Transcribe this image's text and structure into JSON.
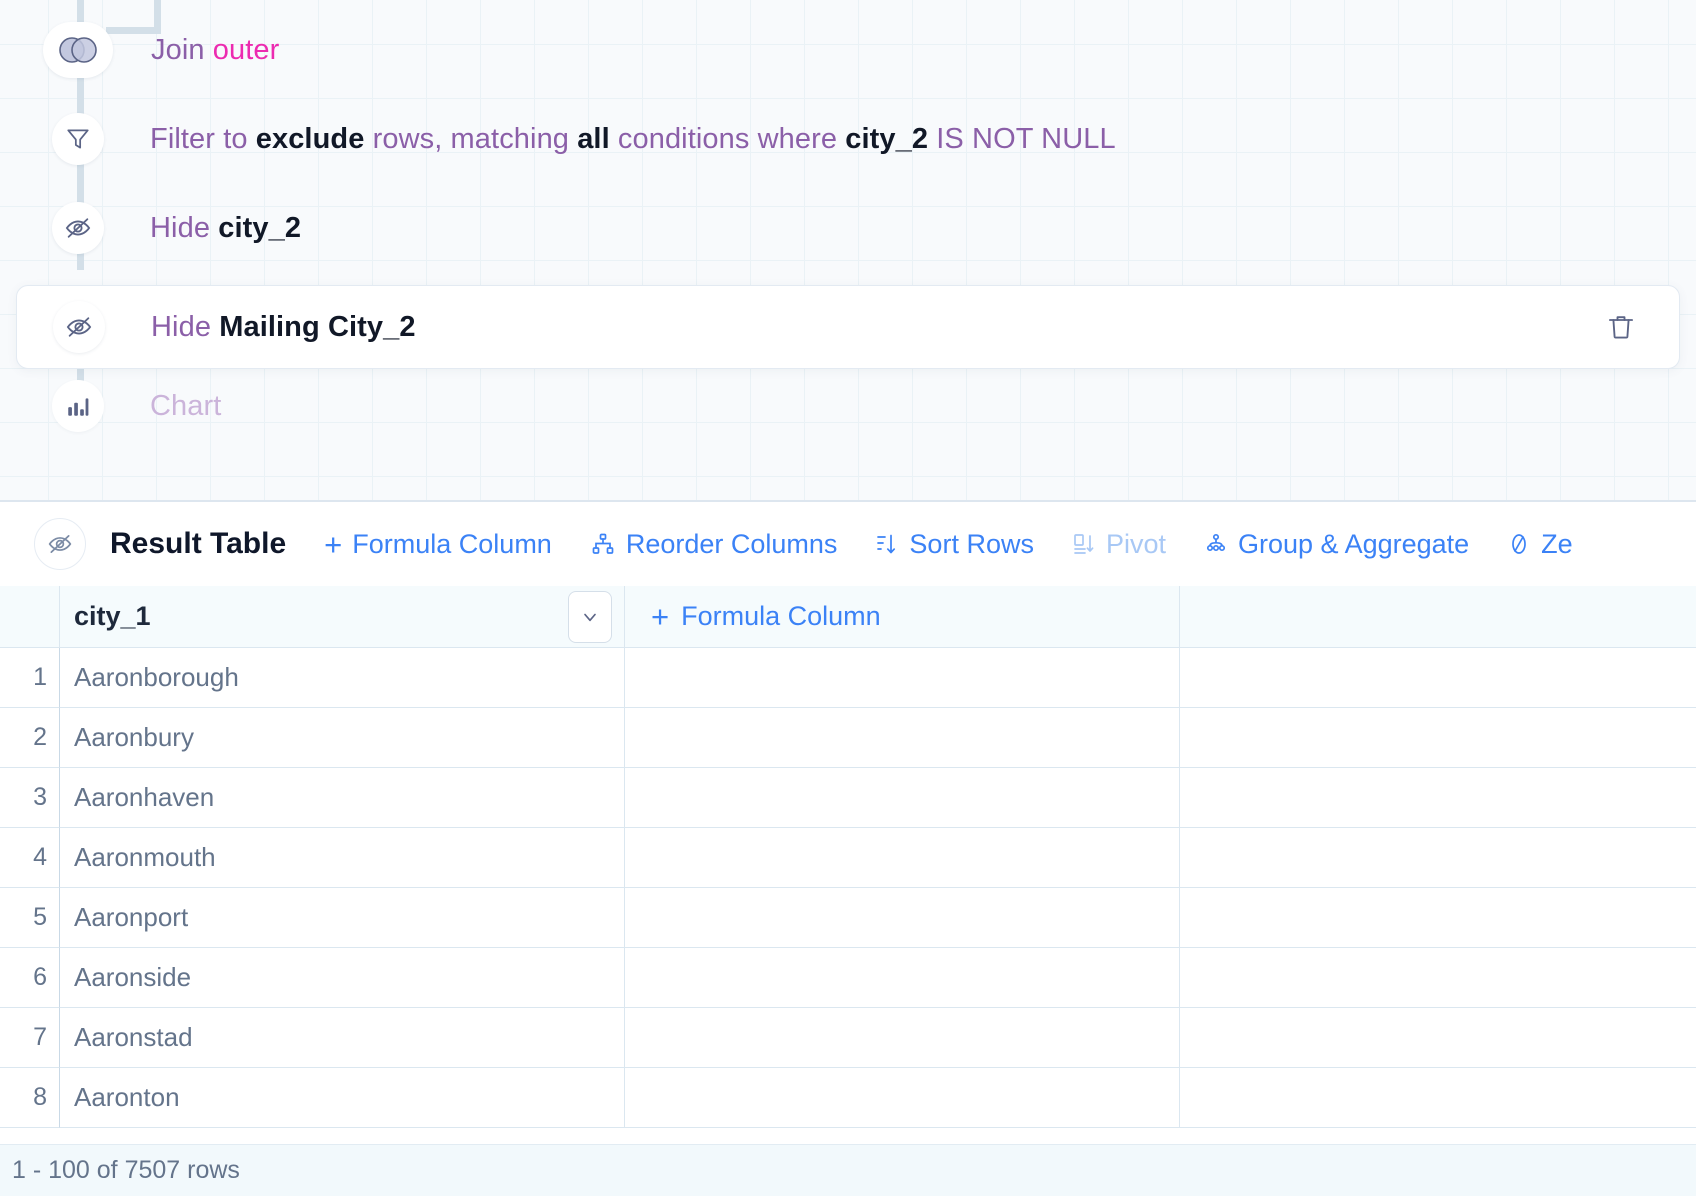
{
  "pipeline": {
    "steps": [
      {
        "id": "join",
        "icon": "venn-join-icon",
        "prefix": "Join",
        "value": "outer",
        "state": "normal"
      },
      {
        "id": "filter",
        "icon": "funnel-filter-icon",
        "text_part1": "Filter to ",
        "bold1": "exclude",
        "text_part2": " rows, matching ",
        "bold2": "all",
        "text_part3": " conditions where ",
        "bold3": "city_2",
        "text_part4": " IS NOT NULL",
        "state": "normal"
      },
      {
        "id": "hide-city-2",
        "icon": "eye-off-icon",
        "prefix": "Hide",
        "value": "city_2",
        "state": "normal"
      },
      {
        "id": "hide-mailing-city-2",
        "icon": "eye-off-icon",
        "prefix": "Hide",
        "value": "Mailing City_2",
        "state": "selected",
        "delete_icon": "trash-icon"
      },
      {
        "id": "chart",
        "icon": "bar-chart-icon",
        "prefix": "Chart",
        "value": "",
        "state": "disabled"
      }
    ]
  },
  "result": {
    "eye_icon": "eye-off-icon",
    "title": "Result Table",
    "toolbar": [
      {
        "id": "formula-column",
        "icon": "plus-icon",
        "label": "Formula Column",
        "disabled": false
      },
      {
        "id": "reorder-columns",
        "icon": "reorder-icon",
        "label": "Reorder Columns",
        "disabled": false
      },
      {
        "id": "sort-rows",
        "icon": "sort-icon",
        "label": "Sort Rows",
        "disabled": false
      },
      {
        "id": "pivot",
        "icon": "pivot-icon",
        "label": "Pivot",
        "disabled": true
      },
      {
        "id": "group-aggregate",
        "icon": "group-icon",
        "label": "Group & Aggregate",
        "disabled": false
      },
      {
        "id": "zero-fill",
        "icon": "zero-icon",
        "label": "Ze",
        "disabled": false
      }
    ],
    "table": {
      "columns": [
        {
          "id": "city_1",
          "label": "city_1",
          "caret_icon": "chevron-down-icon"
        },
        {
          "id": "add-formula",
          "label": "Formula Column",
          "icon": "plus-icon"
        }
      ],
      "rows": [
        {
          "n": "1",
          "city_1": "Aaronborough"
        },
        {
          "n": "2",
          "city_1": "Aaronbury"
        },
        {
          "n": "3",
          "city_1": "Aaronhaven"
        },
        {
          "n": "4",
          "city_1": "Aaronmouth"
        },
        {
          "n": "5",
          "city_1": "Aaronport"
        },
        {
          "n": "6",
          "city_1": "Aaronside"
        },
        {
          "n": "7",
          "city_1": "Aaronstad"
        },
        {
          "n": "8",
          "city_1": "Aaronton"
        }
      ]
    },
    "status": "1 - 100 of 7507 rows"
  },
  "colors": {
    "accent_blue": "#3b82f6",
    "accent_blue_disabled": "#a8c8f5",
    "purple": "#8b5fa8",
    "pink": "#ec2bb0",
    "rail": "#d3dfe8",
    "grid_line": "#eaf2f6"
  }
}
